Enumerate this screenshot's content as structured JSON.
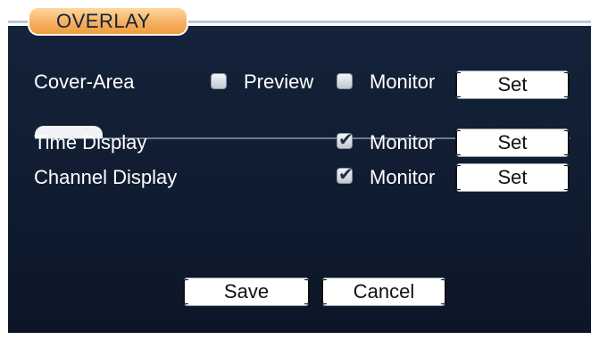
{
  "window": {
    "title": "OVERLAY"
  },
  "rows": {
    "cover_area": {
      "label": "Cover-Area",
      "preview": {
        "label": "Preview",
        "checked": false
      },
      "monitor": {
        "label": "Monitor",
        "checked": false
      },
      "set_label": "Set"
    },
    "time_display": {
      "label": "Time Display",
      "monitor": {
        "label": "Monitor",
        "checked": true
      },
      "set_label": "Set"
    },
    "channel_display": {
      "label": "Channel Display",
      "monitor": {
        "label": "Monitor",
        "checked": true
      },
      "set_label": "Set"
    }
  },
  "footer": {
    "save_label": "Save",
    "cancel_label": "Cancel"
  },
  "colors": {
    "panel": "#14233a",
    "tab": "#f5b062",
    "text": "#ffffff"
  }
}
